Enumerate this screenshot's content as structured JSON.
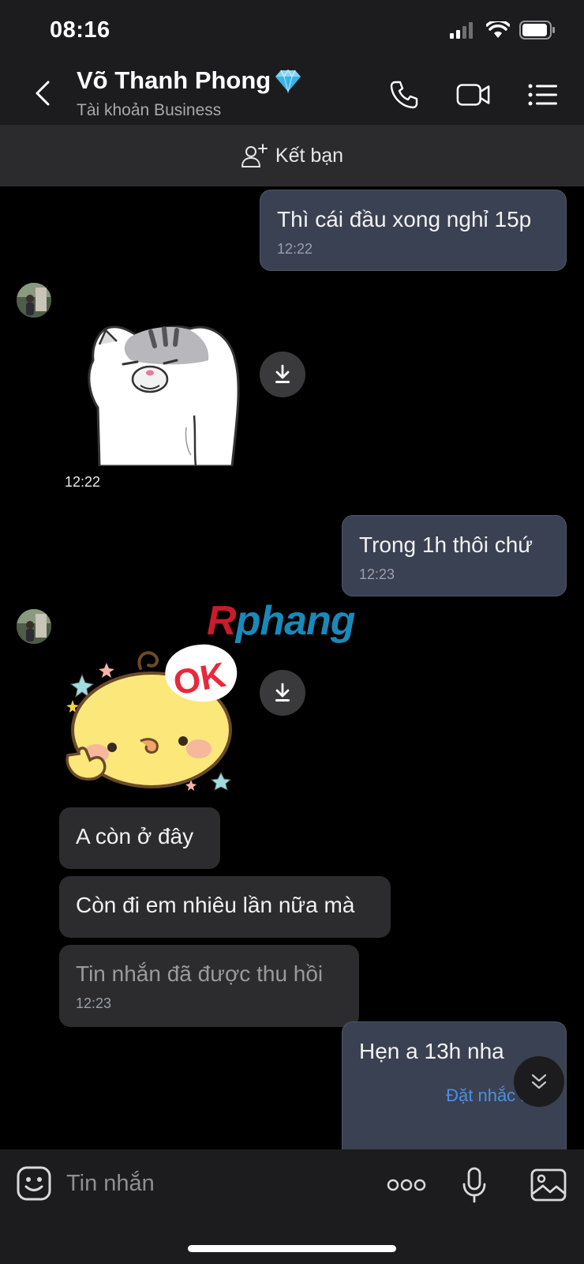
{
  "status_bar": {
    "time": "08:16"
  },
  "header": {
    "contact_name": "Võ Thanh Phong",
    "badge_icon": "diamond-icon",
    "subtitle": "Tài khoản Business"
  },
  "friend_bar": {
    "label": "Kết bạn"
  },
  "watermark": {
    "part1": "R",
    "part2": "phang"
  },
  "messages": [
    {
      "from": "me",
      "text": "Thì cái đầu xong nghỉ 15p",
      "time": "12:22"
    },
    {
      "from": "contact",
      "type": "sticker",
      "sticker": "cat-sticker",
      "time": "12:22"
    },
    {
      "from": "me",
      "text": "Trong 1h thôi chứ",
      "time": "12:23"
    },
    {
      "from": "contact",
      "type": "sticker",
      "sticker": "chick-ok-sticker",
      "sticker_text": "OK"
    },
    {
      "from": "contact",
      "text": "A còn ở đây"
    },
    {
      "from": "contact",
      "text": "Còn đi em nhiêu lần nữa mà"
    },
    {
      "from": "contact",
      "text": "Tin nhắn đã được thu hồi",
      "time": "12:23",
      "recalled": true
    },
    {
      "from": "me",
      "text": "Hẹn a 13h nha",
      "action": "Đặt nhắc hẹn"
    }
  ],
  "input_bar": {
    "placeholder": "Tin nhắn"
  },
  "colors": {
    "outgoing_bubble": "#3a4152",
    "incoming_bubble": "#2c2c2e",
    "link": "#4a90e2"
  }
}
